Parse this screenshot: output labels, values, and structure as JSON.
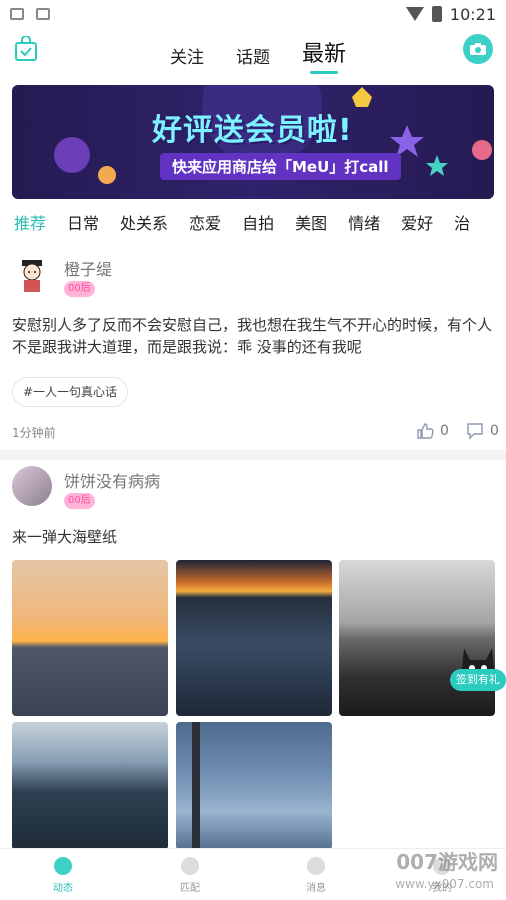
{
  "status": {
    "time": "10:21"
  },
  "nav": {
    "tabs": [
      "关注",
      "话题",
      "最新"
    ],
    "active_tab": "最新"
  },
  "banner": {
    "title": "好评送会员啦!",
    "subtitle": "快来应用商店给「MeU」打call"
  },
  "categories": [
    "推荐",
    "日常",
    "处关系",
    "恋爱",
    "自拍",
    "美图",
    "情绪",
    "爱好",
    "治"
  ],
  "posts": [
    {
      "username": "橙子缇",
      "age_tag": "00后",
      "text": "安慰别人多了反而不会安慰自己，我也想在我生气不开心的时候，有个人不是跟我讲大道理，而是跟我说：乖 没事的还有我呢",
      "topic": "#一人一句真心话",
      "time": "1分钟前",
      "likes": "0",
      "comments": "0"
    },
    {
      "username": "饼饼没有病病",
      "age_tag": "00后",
      "text": "来一弹大海壁纸"
    }
  ],
  "checkin": {
    "label": "签到有礼"
  },
  "bottom_nav": [
    "动态",
    "匹配",
    "消息",
    "我的"
  ],
  "watermark": {
    "text": "007游戏网",
    "url": "www.yx007.com"
  },
  "colors": {
    "accent": "#2ccbc0",
    "badge_bg": "#ffb3d9",
    "badge_text": "#ff4f9a"
  }
}
